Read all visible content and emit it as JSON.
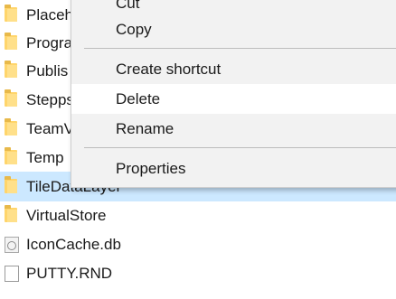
{
  "files": [
    {
      "name": "Placeh",
      "type": "folder",
      "selected": false
    },
    {
      "name": "Progra",
      "type": "folder",
      "selected": false
    },
    {
      "name": "Publis",
      "type": "folder",
      "selected": false
    },
    {
      "name": "Stepps",
      "type": "folder",
      "selected": false
    },
    {
      "name": "TeamV",
      "type": "folder",
      "selected": false
    },
    {
      "name": "Temp",
      "type": "folder",
      "selected": false
    },
    {
      "name": "TileDataLayer",
      "type": "folder",
      "selected": true
    },
    {
      "name": "VirtualStore",
      "type": "folder",
      "selected": false
    },
    {
      "name": "IconCache.db",
      "type": "db-file",
      "selected": false
    },
    {
      "name": "PUTTY.RND",
      "type": "file",
      "selected": false
    }
  ],
  "context_menu": {
    "cut": "Cut",
    "copy": "Copy",
    "create_shortcut": "Create shortcut",
    "delete": "Delete",
    "rename": "Rename",
    "properties": "Properties",
    "hovered_item": "Delete"
  },
  "colors": {
    "selection": "#cce8ff",
    "menu_background": "#f2f2f2",
    "menu_hover": "#ffffff",
    "folder": "#ffd56b"
  }
}
